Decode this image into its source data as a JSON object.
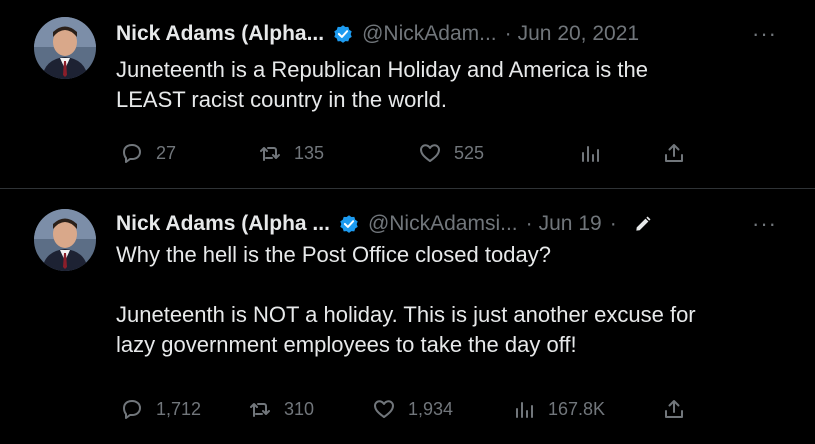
{
  "tweets": [
    {
      "name": "Nick Adams (Alpha...",
      "handle": "@NickAdam...",
      "separator": "·",
      "date": "Jun 20, 2021",
      "more": "···",
      "text": "Juneteenth is a Republican Holiday and America is the\nLEAST racist country in the world.",
      "replies": "27",
      "retweets": "135",
      "likes": "525",
      "views": "",
      "edited": false
    },
    {
      "name": "Nick Adams (Alpha ...",
      "handle": "@NickAdamsi...",
      "separator": "·",
      "date": "Jun 19",
      "separator2": "·",
      "more": "···",
      "text": "Why the hell is the Post Office closed today?\n\nJuneteenth is NOT a holiday. This is just another excuse for\nlazy government employees to take the day off!",
      "replies": "1,712",
      "retweets": "310",
      "likes": "1,934",
      "views": "167.8K",
      "edited": true
    }
  ],
  "colors": {
    "background": "#000000",
    "text": "#e7e9ea",
    "muted": "#71767b",
    "verified": "#1d9bf0",
    "divider": "#2f3336"
  },
  "icons": [
    "verified-badge-icon",
    "reply-icon",
    "retweet-icon",
    "like-icon",
    "views-icon",
    "share-icon",
    "edit-pencil-icon",
    "more-icon"
  ]
}
